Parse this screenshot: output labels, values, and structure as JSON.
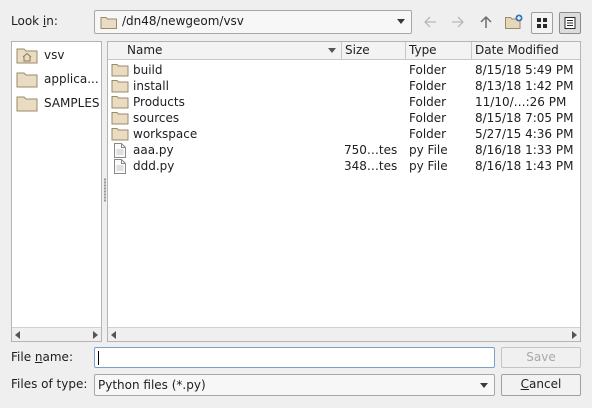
{
  "look_in": {
    "label_pre": "Look ",
    "label_u": "i",
    "label_post": "n:",
    "path": "/dn48/newgeom/vsv"
  },
  "toolbar": {
    "icons": [
      "back-icon",
      "forward-icon",
      "parent-directory-icon",
      "new-folder-icon",
      "icon-view-icon",
      "detail-view-icon"
    ]
  },
  "sidebar": {
    "items": [
      {
        "label": "vsv",
        "icon": "home-folder-icon"
      },
      {
        "label": "applica...",
        "icon": "folder-icon"
      },
      {
        "label": "SAMPLES",
        "icon": "folder-icon"
      }
    ]
  },
  "file_list": {
    "columns": [
      "Name",
      "Size",
      "Type",
      "Date Modified"
    ],
    "rows": [
      {
        "name": "build",
        "size": "",
        "type": "Folder",
        "date": "8/15/18 5:49 PM",
        "icon": "folder-icon"
      },
      {
        "name": "install",
        "size": "",
        "type": "Folder",
        "date": "8/13/18 1:42 PM",
        "icon": "folder-icon"
      },
      {
        "name": "Products",
        "size": "",
        "type": "Folder",
        "date": "11/10/…:26 PM",
        "icon": "folder-icon"
      },
      {
        "name": "sources",
        "size": "",
        "type": "Folder",
        "date": "8/15/18 7:05 PM",
        "icon": "folder-icon"
      },
      {
        "name": "workspace",
        "size": "",
        "type": "Folder",
        "date": "5/27/15 4:36 PM",
        "icon": "folder-icon"
      },
      {
        "name": "aaa.py",
        "size": "750…tes",
        "type": "py File",
        "date": "8/16/18 1:33 PM",
        "icon": "file-icon"
      },
      {
        "name": "ddd.py",
        "size": "348…tes",
        "type": "py File",
        "date": "8/16/18 1:43 PM",
        "icon": "file-icon"
      }
    ]
  },
  "file_name": {
    "label_pre": "File ",
    "label_u": "n",
    "label_post": "ame:",
    "value": ""
  },
  "file_type": {
    "label_pre": "Files of type:",
    "selected": "Python files (*.py)"
  },
  "buttons": {
    "save": "Save",
    "cancel_u": "C",
    "cancel_post": "ancel"
  }
}
